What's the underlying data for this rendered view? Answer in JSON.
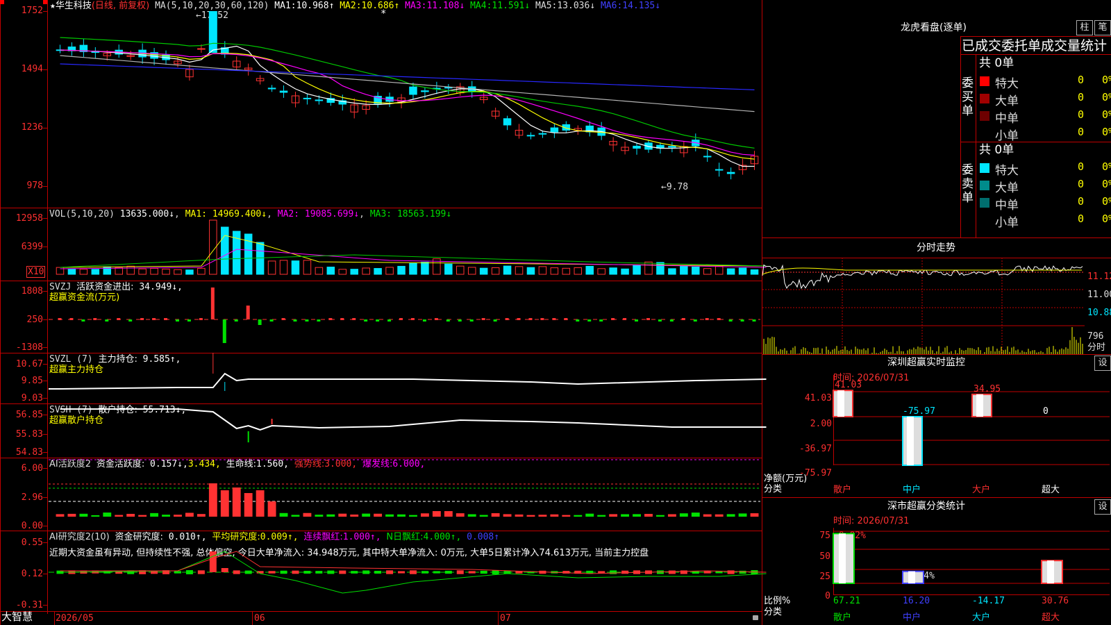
{
  "window": {
    "stock_name": "华生科技",
    "period_label": "(日线, 前复权)",
    "app_name": "大智慧",
    "date_start": "2026/05",
    "month_06": "06",
    "month_07": "07",
    "star_marker": "★"
  },
  "colors": {
    "frame": "#c00000",
    "up": "#ff3232",
    "down": "#00e6ff",
    "ma1": "#ffffff",
    "ma2": "#ffff00",
    "ma3": "#ff00ff",
    "ma4": "#00c800",
    "ma5": "#b4b4b4",
    "ma6": "#2828ff"
  },
  "main_panel": {
    "ma_params": "MA(5,10,20,30,60,120)",
    "ma1_label": "MA1:",
    "ma1_value": "10.968↑",
    "ma2_label": "MA2:",
    "ma2_value": "10.686↑",
    "ma3_label": "MA3:",
    "ma3_value": "11.108↓",
    "ma4_label": "MA4:",
    "ma4_value": "11.591↓",
    "ma5_label": "MA5:",
    "ma5_value": "13.036↓",
    "ma6_label": "MA6:",
    "ma6_value": "14.135↓",
    "y_ticks": [
      "1752",
      "1494",
      "1236",
      "978"
    ],
    "high_mark": "17.52",
    "low_mark": "9.78"
  },
  "vol_panel": {
    "title": "VOL(5,10,20)",
    "value": "13635.000↓",
    "ma1": "MA1: 14969.400↓",
    "ma2": "MA2: 19085.699↓",
    "ma3": "MA3: 18563.199↓",
    "y_ticks": [
      "12958",
      "6399"
    ],
    "unit": "X10"
  },
  "svzj_panel": {
    "title": "SVZJ",
    "label": "活跃资金进出:",
    "value": "34.949↓,",
    "subtitle": "超赢资金流(万元)",
    "y_ticks": [
      "1808",
      "250",
      "-1308"
    ]
  },
  "svzl_panel": {
    "title": "SVZL (7)",
    "label": "主力持仓:",
    "value": "9.585↑,",
    "subtitle": "超赢主力持仓",
    "y_ticks": [
      "10.67",
      "9.85",
      "9.03"
    ]
  },
  "svsh_panel": {
    "title": "SVSH (7)",
    "label": "散户持仓:",
    "value": "55.713↓,",
    "subtitle": "超赢散户持仓",
    "y_ticks": [
      "56.85",
      "55.83",
      "54.83"
    ]
  },
  "ai_active_panel": {
    "title": "AI活跃度2",
    "label": "资金活跃度:",
    "value": "0.157↓,",
    "value2": "3.434,",
    "life_label": "生命线:",
    "life_value": "1.560,",
    "strong_label": "强势线:",
    "strong_value": "3.000,",
    "burst_label": "爆发线:",
    "burst_value": "6.000,",
    "y_ticks": [
      "6.00",
      "2.96",
      "0.00"
    ]
  },
  "ai_research_panel": {
    "title": "AI研究度2(10)",
    "label": "资金研究度:",
    "value": "0.010↑,",
    "avg_label": "平均研究度:",
    "avg_value": "0.009↑,",
    "red_label": "连续飘红:",
    "red_value": "1.000↑,",
    "nday_label": "N日飘红:",
    "nday_value": "4.000↑,",
    "extra_value": "0.008↑",
    "comment": "近期大资金虽有异动, 但持续性不强, 总体偏空, 今日大单净流入: 34.948万元, 其中特大单净流入: 0万元, 大单5日累计净入74.613万元, 当前主力控盘",
    "y_ticks": [
      "0.55",
      "0.12",
      "-0.31"
    ]
  },
  "dragon_tiger": {
    "title": "龙虎看盘(逐单)",
    "btn_bar": "柱",
    "btn_pen": "笔",
    "heading": "已成交委托单成交量统计",
    "buy_side": {
      "label": "委买单",
      "total": "共 0单",
      "rows": [
        {
          "name": "特大",
          "count": "0",
          "pct": "0%",
          "color": "#ff0000"
        },
        {
          "name": "大单",
          "count": "0",
          "pct": "0%",
          "color": "#a00000"
        },
        {
          "name": "中单",
          "count": "0",
          "pct": "0%",
          "color": "#6e0000"
        },
        {
          "name": "小单",
          "count": "0",
          "pct": "0%",
          "color": "#000000"
        }
      ]
    },
    "sell_side": {
      "label": "委卖单",
      "total": "共 0单",
      "rows": [
        {
          "name": "特大",
          "count": "0",
          "pct": "0%",
          "color": "#00e6ff"
        },
        {
          "name": "大单",
          "count": "0",
          "pct": "0%",
          "color": "#008c8c"
        },
        {
          "name": "中单",
          "count": "0",
          "pct": "0%",
          "color": "#006e6e"
        },
        {
          "name": "小单",
          "count": "0",
          "pct": "0%",
          "color": "#000000"
        }
      ]
    }
  },
  "intraday": {
    "title": "分时走势",
    "prices": [
      "11.12",
      "11.00",
      "10.88"
    ],
    "vol_value": "796",
    "vol_label": "分时"
  },
  "sz_monitor": {
    "title": "深圳超赢实时监控",
    "time": "时间: 2026/07/31",
    "settings": "设",
    "y_ticks": [
      "41.03",
      "2.00",
      "-36.97",
      "-75.97"
    ],
    "y_unit": "净额(万元)",
    "x_label": "分类",
    "categories": [
      "散户",
      "中户",
      "大户",
      "超大"
    ],
    "values": [
      41.03,
      -75.97,
      34.95,
      0
    ],
    "value_labels": [
      "41.03",
      "-75.97",
      "34.95",
      "0"
    ]
  },
  "sz_classify": {
    "title": "深市超赢分类统计",
    "time": "时间: 2026/07/31",
    "settings": "设",
    "y_ticks": [
      "75",
      "50",
      "25",
      "0"
    ],
    "y_unit": "比例%",
    "x_label": "分类",
    "top_label": "+0.02%",
    "mid_label": "-0.04%",
    "categories": [
      "散户",
      "中户",
      "大户",
      "超大"
    ],
    "values": [
      67.21,
      16.2,
      -14.17,
      30.76
    ],
    "value_labels": [
      "67.21",
      "16.20",
      "-14.17",
      "30.76"
    ]
  }
}
